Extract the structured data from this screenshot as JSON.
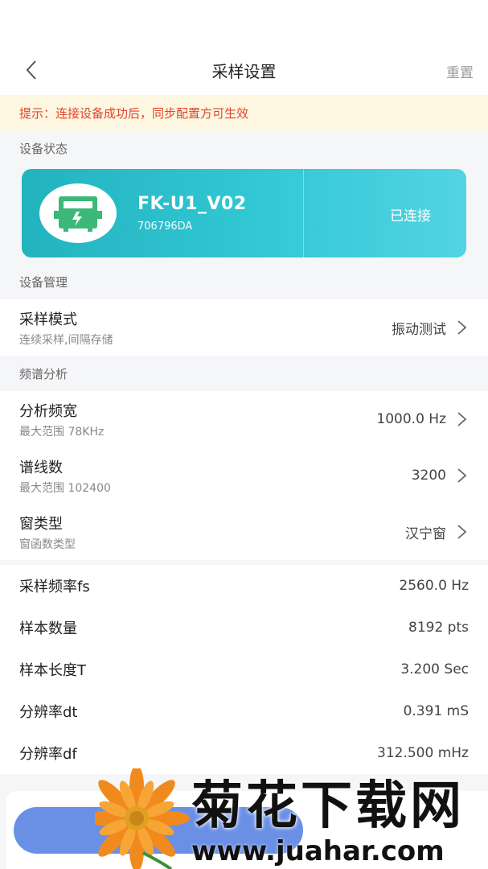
{
  "nav": {
    "title": "采样设置",
    "reset": "重置"
  },
  "tip": "提示：连接设备成功后，同步配置方可生效",
  "device_status": {
    "section": "设备状态",
    "name": "FK-U1_V02",
    "serial": "706796DA",
    "status": "已连接",
    "accent": "#2ab8c4"
  },
  "device_manage": {
    "section": "设备管理",
    "mode": {
      "label": "采样模式",
      "sub": "连续采样,间隔存储",
      "value": "振动测试"
    }
  },
  "spectrum": {
    "section": "频谱分析",
    "items": [
      {
        "label": "分析频宽",
        "sub": "最大范围 78KHz",
        "value": "1000.0 Hz"
      },
      {
        "label": "谱线数",
        "sub": "最大范围 102400",
        "value": "3200"
      },
      {
        "label": "窗类型",
        "sub": "窗函数类型",
        "value": "汉宁窗"
      }
    ]
  },
  "params": [
    {
      "label": "采样频率fs",
      "value": "2560.0 Hz"
    },
    {
      "label": "样本数量",
      "value": "8192 pts"
    },
    {
      "label": "样本长度T",
      "value": "3.200 Sec"
    },
    {
      "label": "分辨率dt",
      "value": "0.391 mS"
    },
    {
      "label": "分辨率df",
      "value": "312.500 mHz"
    }
  ],
  "watermark": {
    "brand": "菊花下载网",
    "url": "www.juahar.com"
  },
  "colors": {
    "tip_bg": "#fdf6e1",
    "tip_text": "#e0462a",
    "button": "#6a90e6"
  }
}
